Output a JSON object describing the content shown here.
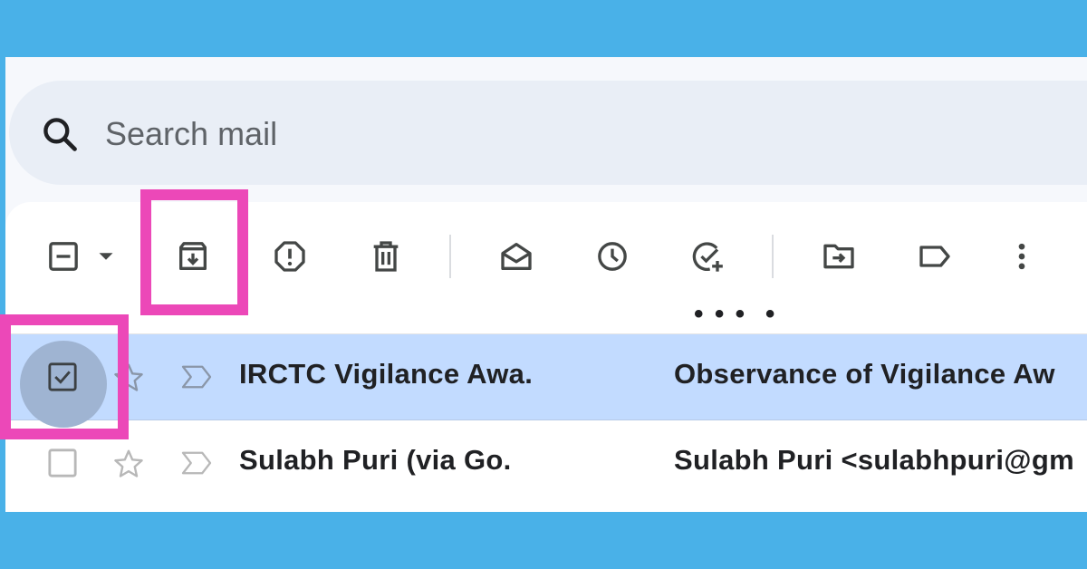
{
  "search": {
    "placeholder": "Search mail"
  },
  "toolbar": {
    "buttons": [
      {
        "name": "select-checkbox",
        "icon": "minus-square-icon"
      },
      {
        "name": "select-dropdown",
        "icon": "caret-down-icon"
      },
      {
        "name": "archive",
        "icon": "archive-icon"
      },
      {
        "name": "report-spam",
        "icon": "report-spam-icon"
      },
      {
        "name": "delete",
        "icon": "trash-icon"
      },
      {
        "name": "mark-as-read",
        "icon": "open-envelope-icon"
      },
      {
        "name": "snooze",
        "icon": "clock-icon"
      },
      {
        "name": "add-to-tasks",
        "icon": "add-task-icon"
      },
      {
        "name": "move-to",
        "icon": "move-to-folder-icon"
      },
      {
        "name": "labels",
        "icon": "label-icon"
      },
      {
        "name": "more",
        "icon": "more-vert-icon"
      }
    ]
  },
  "emails": [
    {
      "sender": "IRCTC Vigilance Awa.",
      "subject": "Observance of Vigilance Aw",
      "selected": true,
      "checked": true
    },
    {
      "sender": "Sulabh Puri (via Go.",
      "subject": "Sulabh Puri <sulabhpuri@gm",
      "selected": false,
      "checked": false
    }
  ],
  "colors": {
    "background": "#49b1e8",
    "highlight": "#ec48b8",
    "selected_row": "#c2dbff",
    "search_bg": "#e9eef6"
  }
}
